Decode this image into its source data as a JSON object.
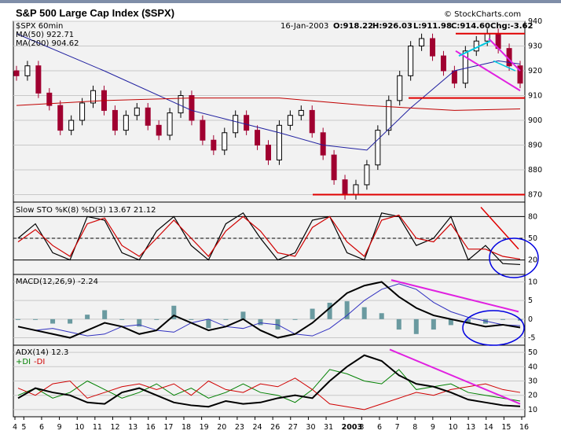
{
  "title": "S&P 500 Large Cap Index ($SPX)",
  "watermark": "© StockCharts.com",
  "quote": {
    "date": "16-Jan-2003",
    "open_label": "O:",
    "open": "918.22",
    "high_label": "H:",
    "high": "926.03",
    "low_label": "L:",
    "low": "911.98",
    "close_label": "C:",
    "close": "914.60",
    "change_label": "Chg:",
    "change": "-3.62"
  },
  "legend": {
    "symbol": "$SPX 60min",
    "ma50": "MA(50) 922.71",
    "ma200": "MA(200) 904.62",
    "sto": "Slow STO %K(8) %D(3)  13.67  21.12",
    "macd": "MACD(12,26,9) -2.24",
    "adx": "ADX(14)  12.3",
    "plus_di": "+DI",
    "minus_di": "-DI"
  },
  "colors": {
    "ma50": "#2020a0",
    "ma200": "#c00000",
    "candle_up": "#000000",
    "candle_down": "#a00030",
    "sto_k": "#000000",
    "sto_d": "#d00000",
    "macd": "#000000",
    "signal": "#3030c0",
    "histogram": "#6a9aa0",
    "adx": "#000000",
    "plus_di": "#008000",
    "minus_di": "#d00000",
    "annotation_red": "#e00000",
    "annotation_magenta": "#e020e0",
    "annotation_cyan": "#00c8e0",
    "annotation_blue": "#0000e0",
    "panel_bg": "#f2f2f2"
  },
  "chart_data": [
    {
      "type": "candlestick",
      "title": "S&P 500 Large Cap Index ($SPX)",
      "interval": "60min",
      "ylim": [
        867,
        940
      ],
      "yticks": [
        870,
        880,
        890,
        900,
        910,
        920,
        930,
        940
      ],
      "xlim": [
        4,
        16.5
      ],
      "x_tick_labels": [
        "4",
        "5",
        "6",
        "9",
        "10",
        "11",
        "12",
        "13",
        "16",
        "17",
        "18",
        "19",
        "20",
        "23",
        "24",
        "26",
        "27",
        "30",
        "31",
        "2003",
        "3",
        "6",
        "7",
        "8",
        "9",
        "10",
        "13",
        "14",
        "15",
        "16"
      ],
      "x_tick_values": [
        4,
        4.4,
        5.2,
        6,
        6.8,
        7.6,
        8.4,
        9.2,
        10,
        10.8,
        11.6,
        12.4,
        13.2,
        14,
        14.8,
        15.6,
        16.4,
        17.2,
        18,
        18.8,
        19.6,
        20.4,
        21.2,
        22,
        22.8,
        23.6,
        24.4,
        25.2,
        26,
        26.8
      ],
      "series": [
        {
          "name": "$SPX",
          "x": [
            4,
            4.5,
            5,
            5.5,
            6,
            6.5,
            7,
            7.5,
            8,
            8.5,
            9,
            9.5,
            10,
            10.5,
            11,
            11.5,
            12,
            12.5,
            13,
            13.5,
            14,
            14.5,
            15,
            15.5,
            16,
            16.5,
            17,
            17.5,
            18,
            18.5,
            19,
            19.5,
            20,
            20.5,
            21,
            21.5,
            22,
            22.5,
            23,
            23.5,
            24,
            24.5,
            25,
            25.5,
            26,
            26.5,
            27
          ],
          "values": [
            918,
            922,
            911,
            906,
            896,
            900,
            907,
            912,
            904,
            896,
            902,
            905,
            898,
            894,
            903,
            910,
            900,
            892,
            888,
            895,
            902,
            896,
            890,
            884,
            898,
            902,
            904,
            895,
            886,
            876,
            870,
            874,
            882,
            896,
            908,
            918,
            930,
            933,
            926,
            920,
            915,
            928,
            932,
            935,
            929,
            922,
            915
          ]
        },
        {
          "name": "MA(50)",
          "x": [
            4,
            8,
            12,
            16,
            18,
            20,
            22,
            24,
            26,
            27
          ],
          "values": [
            935,
            920,
            904,
            895,
            890,
            888,
            905,
            920,
            924,
            922.71
          ]
        },
        {
          "name": "MA(200)",
          "x": [
            4,
            8,
            12,
            16,
            20,
            24,
            27
          ],
          "values": [
            906,
            908,
            909,
            909,
            906,
            904,
            904.62
          ]
        }
      ],
      "annotations": [
        {
          "kind": "support",
          "y": 870
        },
        {
          "kind": "support",
          "y": 909
        },
        {
          "kind": "resistance",
          "y": 935
        }
      ]
    },
    {
      "type": "line",
      "title": "Slow STO %K(8) %D(3)",
      "ylim": [
        0,
        100
      ],
      "yticks": [
        20,
        50,
        80
      ],
      "series": [
        {
          "name": "%K",
          "values": [
            50,
            70,
            30,
            20,
            80,
            75,
            30,
            20,
            60,
            80,
            40,
            20,
            70,
            85,
            50,
            20,
            30,
            75,
            80,
            30,
            20,
            85,
            80,
            40,
            50,
            80,
            20,
            40,
            15,
            13.67
          ]
        },
        {
          "name": "%D",
          "values": [
            45,
            62,
            40,
            25,
            70,
            78,
            40,
            25,
            50,
            75,
            50,
            25,
            60,
            80,
            60,
            30,
            25,
            65,
            80,
            45,
            25,
            75,
            82,
            50,
            45,
            70,
            35,
            35,
            25,
            21.12
          ]
        }
      ]
    },
    {
      "type": "line",
      "title": "MACD(12,26,9)",
      "ylim": [
        -7,
        12
      ],
      "yticks": [
        -5,
        0,
        5,
        10
      ],
      "series": [
        {
          "name": "MACD",
          "values": [
            -2,
            -3,
            -4,
            -5,
            -3,
            -1,
            -2,
            -4,
            -3,
            1,
            -1,
            -3,
            -2,
            0,
            -3,
            -5,
            -4,
            -1,
            3,
            7,
            9,
            10,
            6,
            3,
            1,
            0,
            -1,
            -2,
            -1.5,
            -2.24
          ]
        }
      ]
    },
    {
      "type": "line",
      "title": "ADX(14)",
      "ylim": [
        5,
        55
      ],
      "yticks": [
        10,
        20,
        30,
        40,
        50
      ],
      "series": [
        {
          "name": "ADX",
          "values": [
            18,
            25,
            22,
            20,
            15,
            14,
            22,
            25,
            20,
            15,
            13,
            12,
            16,
            14,
            15,
            18,
            20,
            18,
            30,
            40,
            48,
            44,
            34,
            28,
            26,
            22,
            17,
            15,
            13,
            12.3
          ]
        },
        {
          "name": "+DI",
          "values": [
            20,
            25,
            18,
            22,
            30,
            24,
            18,
            22,
            28,
            20,
            25,
            18,
            22,
            28,
            22,
            20,
            15,
            24,
            38,
            35,
            30,
            28,
            38,
            24,
            26,
            28,
            22,
            20,
            18,
            16
          ]
        },
        {
          "name": "-DI",
          "values": [
            25,
            20,
            28,
            30,
            18,
            22,
            26,
            28,
            24,
            28,
            20,
            30,
            24,
            22,
            28,
            26,
            32,
            24,
            14,
            12,
            10,
            14,
            18,
            22,
            20,
            24,
            26,
            28,
            24,
            22
          ]
        }
      ]
    }
  ]
}
